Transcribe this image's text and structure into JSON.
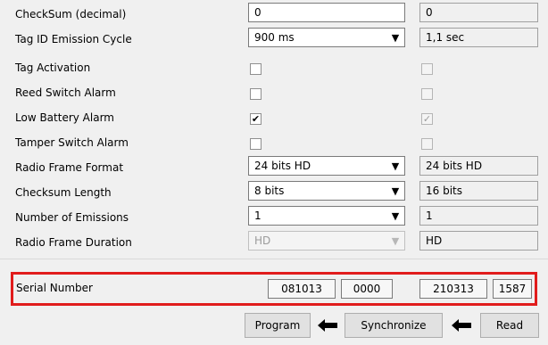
{
  "rows": {
    "checksum": {
      "label": "CheckSum (decimal)",
      "value": "0",
      "current": "0"
    },
    "emission_cycle": {
      "label": "Tag ID Emission Cycle",
      "value": "900 ms",
      "current": "1,1 sec"
    },
    "tag_activation": {
      "label": "Tag Activation"
    },
    "reed_switch": {
      "label": "Reed Switch Alarm"
    },
    "low_battery": {
      "label": "Low Battery Alarm",
      "checked_mark": "✔",
      "current_mark": "✓"
    },
    "tamper_switch": {
      "label": "Tamper Switch Alarm"
    },
    "radio_format": {
      "label": "Radio Frame Format",
      "value": "24 bits HD",
      "current": "24 bits HD"
    },
    "checksum_length": {
      "label": "Checksum Length",
      "value": "8 bits",
      "current": "16 bits"
    },
    "num_emissions": {
      "label": "Number of Emissions",
      "value": "1",
      "current": "1"
    },
    "frame_duration": {
      "label": "Radio Frame Duration",
      "value": "HD",
      "current": "HD"
    }
  },
  "serial": {
    "label": "Serial Number",
    "new_part1": "081013",
    "new_part2": "0000",
    "cur_part1": "210313",
    "cur_part2": "1587"
  },
  "buttons": {
    "program": "Program",
    "synchronize": "Synchronize",
    "read": "Read"
  },
  "icons": {
    "dropdown": "chevron-down-icon",
    "arrow": "arrow-left-icon"
  },
  "colors": {
    "highlight_border": "#e11c1c",
    "background": "#f0f0f0"
  }
}
